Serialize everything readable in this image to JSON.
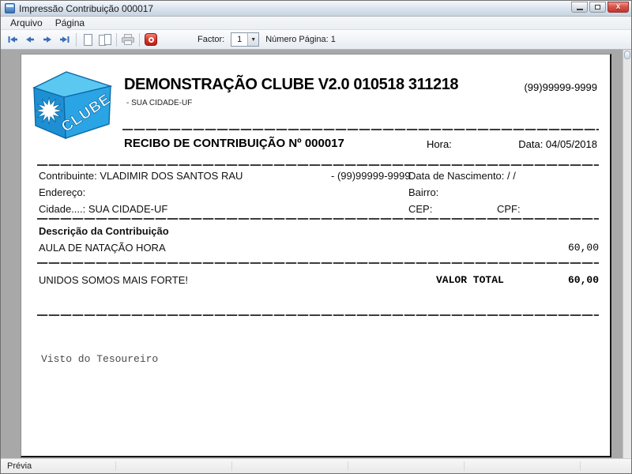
{
  "window": {
    "title": "Impressão Contribuição 000017"
  },
  "menu": {
    "items": [
      "Arquivo",
      "Página"
    ]
  },
  "toolbar": {
    "factor_label": "Factor:",
    "factor_value": "1",
    "dropdown_arrow": "▼",
    "page_label": "Número Página: 1"
  },
  "icons": {
    "app": "form-window-icon",
    "window_controls": [
      "minimize-icon",
      "restore-icon",
      "close-icon"
    ],
    "navigation": [
      "first-page-icon",
      "prev-page-icon",
      "next-page-icon",
      "last-page-icon"
    ],
    "view": [
      "single-page-icon",
      "two-pages-icon"
    ],
    "print": "printer-icon",
    "stop": "stop-close-icon",
    "logo": "clube-cube-logo",
    "star": "starburst-icon"
  },
  "receipt": {
    "logo_text": "CLUBE",
    "header_title": "DEMONSTRAÇÃO CLUBE V2.0 010518 311218",
    "header_subtitle": "- SUA CIDADE-UF",
    "header_phone": "(99)99999-9999",
    "receipt_title": "RECIBO DE CONTRIBUIÇÃO Nº 000017",
    "hora_label": "Hora:",
    "data_label": "Data: 04/05/2018",
    "contribuinte": "Contribuinte: VLADIMIR DOS SANTOS RAU",
    "contribuinte_phone": "- (99)99999-9999",
    "nascimento": "Data de Nascimento:  / /",
    "endereco": "Endereço:",
    "bairro": "Bairro:",
    "cidade": "Cidade....: SUA CIDADE-UF",
    "cep": "CEP:",
    "cpf": "CPF:",
    "descricao_header": "Descrição da Contribuição",
    "item_desc": "AULA DE NATAÇÃO HORA",
    "item_value": "60,00",
    "footer_msg": "UNIDOS SOMOS MAIS FORTE!",
    "total_label": "VALOR TOTAL",
    "total_value": "60,00",
    "visto": "Visto do Tesoureiro"
  },
  "statusbar": {
    "text": "Prévia"
  },
  "colors": {
    "accent_arrow_blue": "#3a6db4",
    "logo_front_blue": "#2aa4e4",
    "logo_left_blue": "#1e8fd2",
    "logo_top_blue": "#5bc8f2",
    "stop_red": "#c0392e",
    "close_red": "#c0392e",
    "preview_gray": "#a8a8a8"
  }
}
